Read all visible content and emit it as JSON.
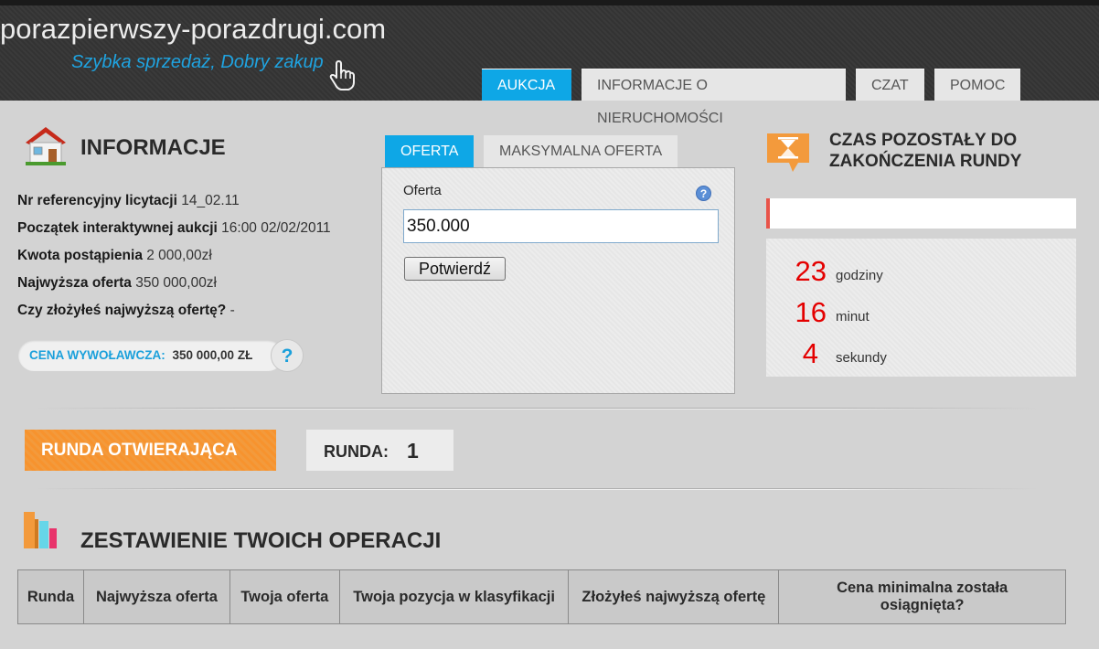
{
  "site": {
    "logo_text": "porazpierwszy-porazdrugi.com",
    "tagline": "Szybka sprzedaż, Dobry zakup"
  },
  "nav": {
    "tabs": [
      {
        "label": "AUKCJA",
        "active": true
      },
      {
        "label": "INFORMACJE O NIERUCHOMOŚCI",
        "active": false
      },
      {
        "label": "CZAT",
        "active": false
      },
      {
        "label": "POMOC",
        "active": false
      }
    ]
  },
  "info": {
    "title": "INFORMACJE",
    "rows": [
      {
        "label": "Nr referencyjny licytacji",
        "value": "14_02.11"
      },
      {
        "label": "Początek interaktywnej aukcji",
        "value": "16:00 02/02/2011"
      },
      {
        "label": "Kwota postąpienia",
        "value": "2 000,00zł"
      },
      {
        "label": "Najwyższa oferta",
        "value": "350 000,00zł"
      },
      {
        "label": "Czy złożyłeś najwyższą ofertę?",
        "value": "-"
      }
    ],
    "starting_price_label": "CENA WYWOŁAWCZA:",
    "starting_price_value": "350 000,00 ZŁ",
    "help_symbol": "?"
  },
  "offer": {
    "tabs": [
      {
        "label": "OFERTA",
        "active": true
      },
      {
        "label": "MAKSYMALNA OFERTA",
        "active": false
      }
    ],
    "field_label": "Oferta",
    "field_value": "350.000",
    "help_symbol": "?",
    "confirm_label": "Potwierdź"
  },
  "timer": {
    "title_line1": "CZAS POZOSTAŁY DO",
    "title_line2": "ZAKOŃCZENIA RUNDY",
    "hours": "23",
    "hours_label": "godziny",
    "minutes": "16",
    "minutes_label": "minut",
    "seconds": "4",
    "seconds_label": "sekundy",
    "accent_color": "#e40000"
  },
  "round": {
    "status_label": "RUNDA OTWIERAJĄCA",
    "round_label": "RUNDA:",
    "round_number": "1",
    "status_color": "#f7932e"
  },
  "summary": {
    "title": "ZESTAWIENIE TWOICH OPERACJI",
    "columns": [
      "Runda",
      "Najwyższa oferta",
      "Twoja oferta",
      "Twoja pozycja w klasyfikacji",
      "Złożyłeś najwyższą ofertę",
      "Cena minimalna została osiągnięta?"
    ]
  },
  "colors": {
    "accent_blue": "#0ea7e6",
    "header_dark": "#363636",
    "timer_red": "#e40000",
    "round_orange": "#f7932e"
  }
}
